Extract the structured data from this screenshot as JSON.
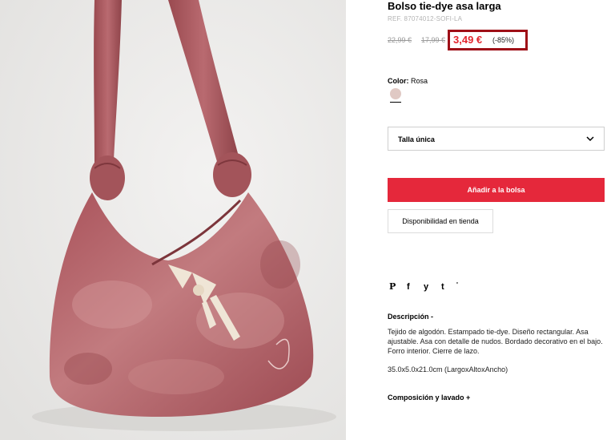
{
  "product": {
    "title": "Bolso tie-dye asa larga",
    "reference": "REF. 87074012-SOFI-LA",
    "price_original": "22,99 €",
    "price_previous": "17,99 €",
    "price_current": "3,49 €",
    "discount": "(-85%)"
  },
  "color": {
    "label": "Color:",
    "value": "Rosa",
    "swatch_hex": "#e0c9c4"
  },
  "size": {
    "selected": "Talla única",
    "icon": "chevron-down-icon"
  },
  "actions": {
    "add_to_bag": "Añadir a la bolsa",
    "store_availability": "Disponibilidad en tienda"
  },
  "social": {
    "pinterest": "P",
    "facebook": "f",
    "twitter": "y",
    "tumblr": "t",
    "more": "'"
  },
  "description": {
    "title": "Descripción  -",
    "body": "Tejido de algodón. Estampado tie-dye. Diseño rectangular. Asa ajustable. Asa con detalle de nudos. Bordado decorativo en el bajo. Forro interior. Cierre de lazo.",
    "dimensions": "35.0x5.0x21.0cm (LargoxAltoxAncho)"
  },
  "composition": {
    "title": "Composición y lavado  +"
  },
  "colors": {
    "accent_red": "#e5283b",
    "price_red": "#e3262e",
    "highlight_box": "#9e0f17",
    "bag_pink": "#b8676c"
  }
}
